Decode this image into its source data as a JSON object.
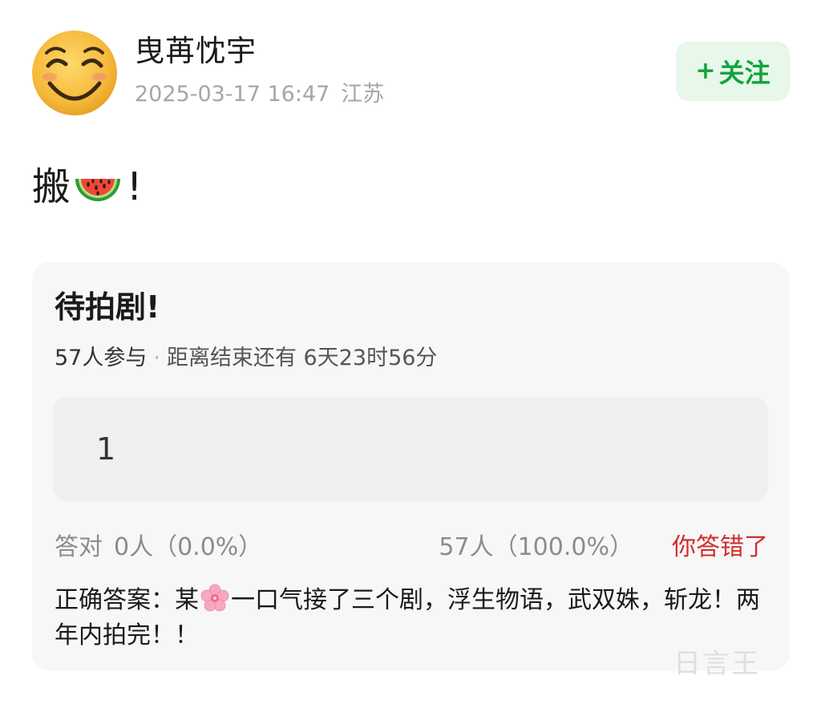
{
  "header": {
    "username": "曳苒忱宇",
    "timestamp": "2025-03-17 16:47",
    "location": "江苏",
    "avatar_icon": "smiley-face-avatar",
    "follow": {
      "plus": "+",
      "label": "关注"
    }
  },
  "post": {
    "prefix": "搬",
    "emoji": "watermelon-emoji",
    "suffix": "!"
  },
  "poll": {
    "title": "待拍剧!",
    "participants": "57人参与",
    "separator": "·",
    "remaining": "距离结束还有 6天23时56分",
    "option": "1",
    "correct_label": "答对",
    "correct_stats": "0人（0.0%）",
    "wrong_stats": "57人（100.0%）",
    "verdict": "你答错了",
    "answer_prefix": "正确答案：某",
    "answer_emoji": "cherry-blossom-emoji",
    "answer_text": "一口气接了三个剧，浮生物语，武双姝，斩龙！两年内拍完！！"
  },
  "watermark": "日言王"
}
